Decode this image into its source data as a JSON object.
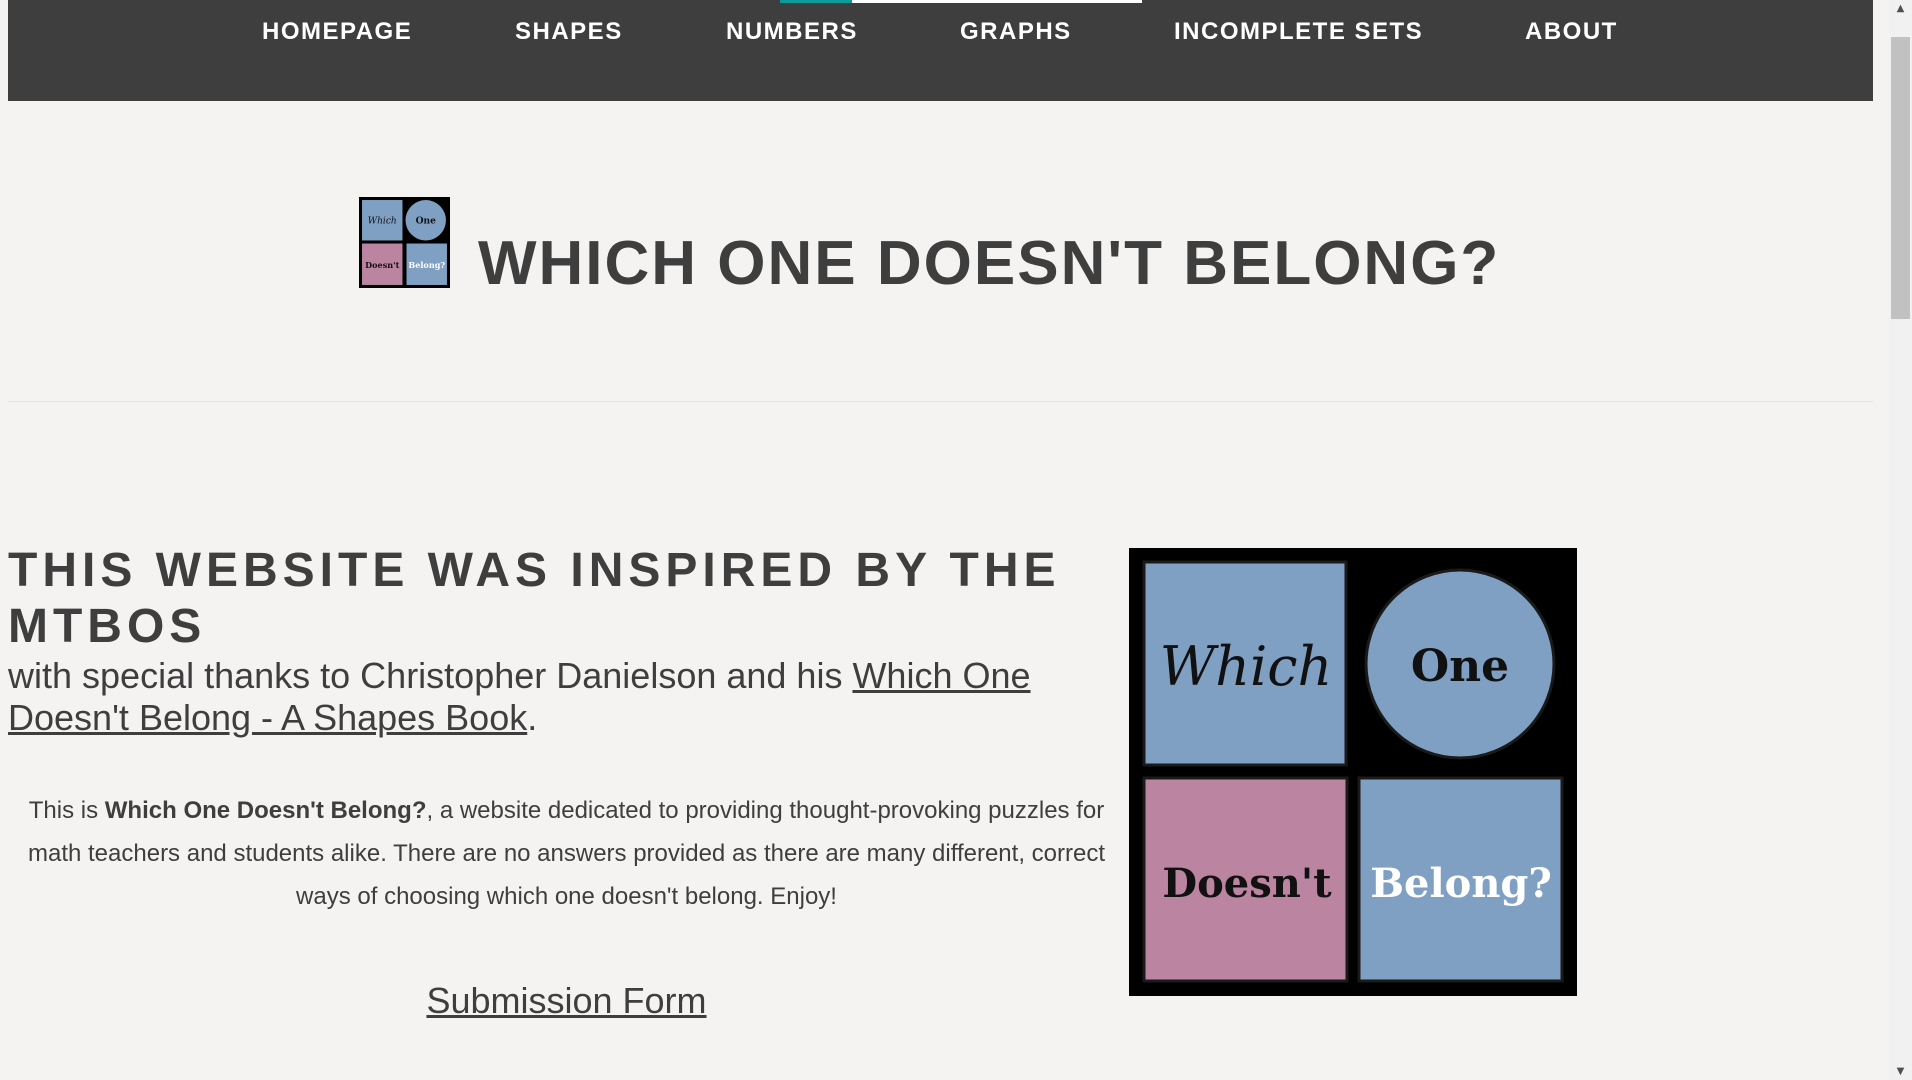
{
  "nav": {
    "items": [
      {
        "label": "HOMEPAGE"
      },
      {
        "label": "SHAPES"
      },
      {
        "label": "NUMBERS"
      },
      {
        "label": "GRAPHS"
      },
      {
        "label": "INCOMPLETE SETS"
      },
      {
        "label": "ABOUT"
      }
    ]
  },
  "header": {
    "title": "WHICH ONE DOESN'T BELONG?",
    "logo_words": [
      "Which",
      "One",
      "Doesn't",
      "Belong?"
    ]
  },
  "intro": {
    "heading": "THIS WEBSITE WAS INSPIRED BY THE MTBOS",
    "thanks_prefix": "with special thanks to Christopher Danielson and his ",
    "thanks_link": "Which One Doesn't Belong - A Shapes Book",
    "thanks_suffix": ".",
    "body_prefix": "This is ",
    "body_bold": "Which One Doesn't Belong?",
    "body_suffix": ", a website dedicated to providing thought-provoking puzzles for math teachers and students alike. There are no answers provided as there are many different, correct ways of choosing which one doesn't belong. Enjoy!",
    "submission_label": "Submission Form"
  },
  "colors": {
    "nav_bg": "#3e3e3e",
    "accent": "#0d9a9a",
    "page_bg": "#f5f3f1",
    "text": "#3e3e3e",
    "logo_blue": "#7f9fc3",
    "logo_pink": "#bb84a0"
  },
  "icons": {
    "scroll_up": "triangle-up-icon",
    "scroll_down": "triangle-down-icon"
  }
}
